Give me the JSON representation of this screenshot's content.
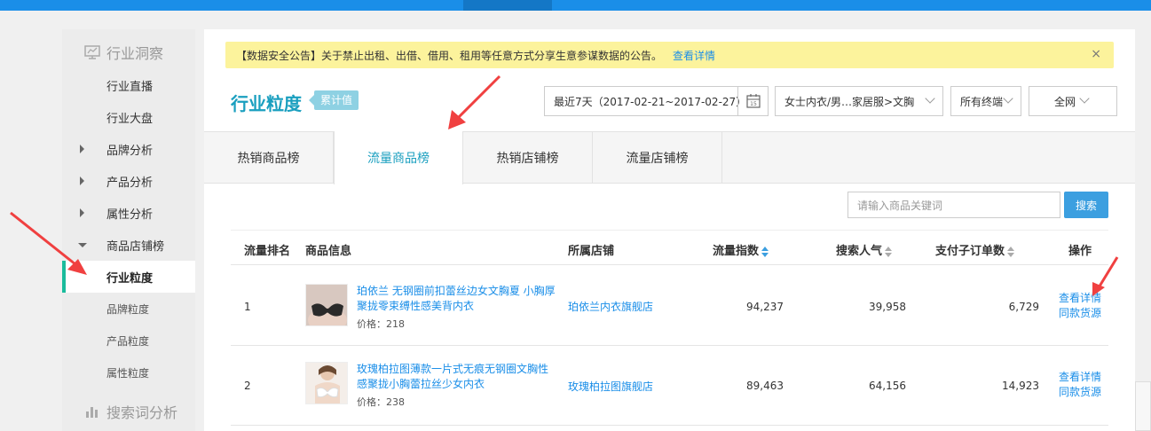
{
  "sidebar": {
    "group1": "行业洞察",
    "items": [
      {
        "label": "行业直播"
      },
      {
        "label": "行业大盘"
      },
      {
        "label": "品牌分析"
      },
      {
        "label": "产品分析"
      },
      {
        "label": "属性分析"
      },
      {
        "label": "商品店铺榜"
      },
      {
        "label": "行业粒度"
      },
      {
        "label": "品牌粒度"
      },
      {
        "label": "产品粒度"
      },
      {
        "label": "属性粒度"
      }
    ],
    "group2": "搜索词分析"
  },
  "notice": {
    "text": "【数据安全公告】关于禁止出租、出借、借用、租用等任意方式分享生意参谋数据的公告。",
    "link": "查看详情",
    "close": "×"
  },
  "header": {
    "title": "行业粒度",
    "badge": "累计值",
    "date_range": "最近7天（2017-02-21~2017-02-27）",
    "calendar_day": "15",
    "category": "女士内衣/男…家居服>文胸",
    "terminal": "所有终端",
    "network": "全网"
  },
  "tabs": [
    "热销商品榜",
    "流量商品榜",
    "热销店铺榜",
    "流量店铺榜"
  ],
  "search": {
    "placeholder": "请输入商品关键词",
    "button": "搜索"
  },
  "table": {
    "headers": {
      "rank": "流量排名",
      "product": "商品信息",
      "shop": "所属店铺",
      "traffic": "流量指数",
      "search": "搜索人气",
      "orders": "支付子订单数",
      "ops": "操作"
    },
    "rows": [
      {
        "rank": "1",
        "name": "珀依兰 无钢圈前扣蕾丝边女文胸夏 小胸厚聚拢零束缚性感美背内衣",
        "price": "价格：218",
        "shop": "珀依兰内衣旗舰店",
        "traffic": "94,237",
        "search": "39,958",
        "orders": "6,729",
        "op1": "查看详情",
        "op2": "同款货源"
      },
      {
        "rank": "2",
        "name": "玫瑰柏拉图薄款一片式无痕无钢圈文胸性感聚拢小胸蕾拉丝少女内衣",
        "price": "价格：238",
        "shop": "玫瑰柏拉图旗舰店",
        "traffic": "89,463",
        "search": "64,156",
        "orders": "14,923",
        "op1": "查看详情",
        "op2": "同款货源"
      }
    ]
  }
}
